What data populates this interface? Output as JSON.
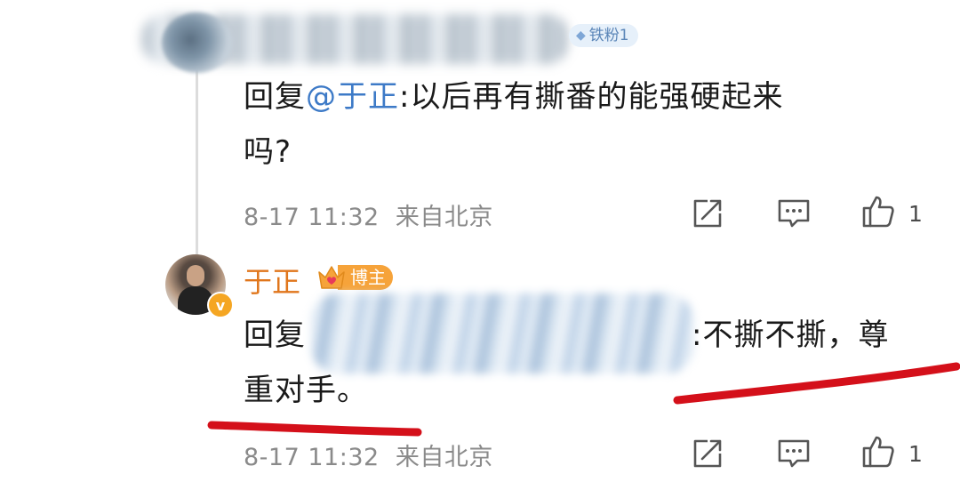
{
  "comment1": {
    "fan_badge": "铁粉1",
    "reply_prefix": "回复",
    "mention": "@于正",
    "text_line1": ":以后再有撕番的能强硬起来",
    "text_line2": "吗?",
    "date": "8-17 11:32",
    "location": "来自北京",
    "like_count": "1"
  },
  "comment2": {
    "author": "于正",
    "blogger_badge": "博主",
    "reply_prefix": "回复",
    "text_line1": ":不撕不撕，尊",
    "text_line2": "重对手。",
    "date": "8-17 11:32",
    "location": "来自北京",
    "like_count": "1"
  },
  "icons": [
    "share-icon",
    "comment-icon",
    "like-icon",
    "verified-v-icon",
    "crown-icon"
  ],
  "colors": {
    "mention_blue": "#3d7ac7",
    "author_orange": "#e0761c",
    "badge_orange": "#f6a33a",
    "meta_gray": "#8a8a8a",
    "annotation_red": "#d4101a"
  }
}
